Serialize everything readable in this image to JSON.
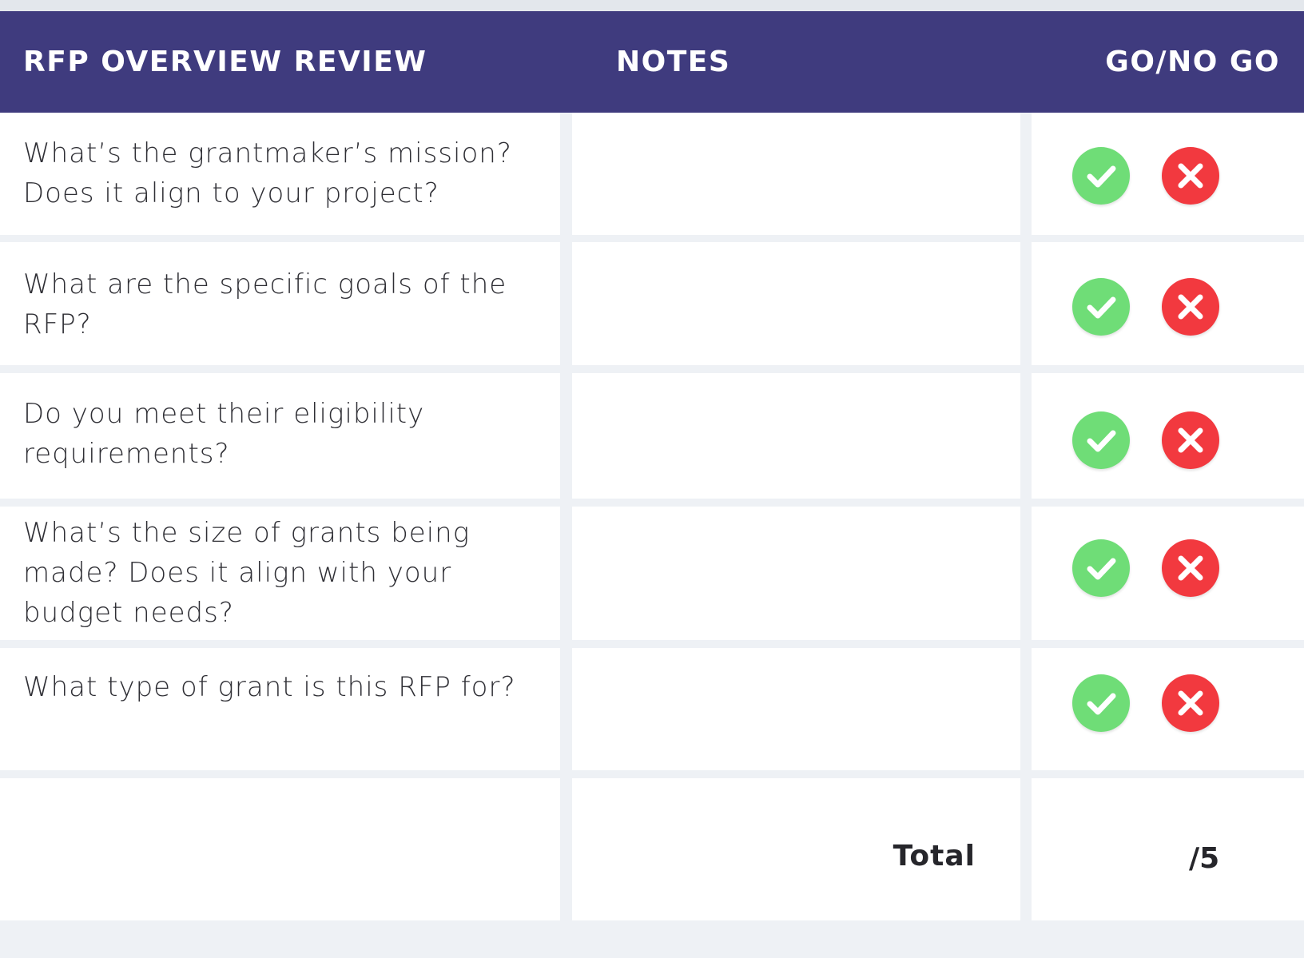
{
  "header": {
    "question_col": "RFP OVERVIEW REVIEW",
    "notes_col": "NOTES",
    "go_col": "GO/NO GO"
  },
  "rows": [
    {
      "question": "What’s the grantmaker’s mission? Does it align to your project?",
      "notes": "",
      "go_icon": "check-icon",
      "nogo_icon": "x-icon"
    },
    {
      "question": "What are the specific goals of the RFP?",
      "notes": "",
      "go_icon": "check-icon",
      "nogo_icon": "x-icon"
    },
    {
      "question": "Do you meet their eligibility requirements?",
      "notes": "",
      "go_icon": "check-icon",
      "nogo_icon": "x-icon"
    },
    {
      "question": "What’s the size of grants being made? Does it align with your budget needs?",
      "notes": "",
      "go_icon": "check-icon",
      "nogo_icon": "x-icon"
    },
    {
      "question": "What type of grant is this RFP for?",
      "notes": "",
      "go_icon": "check-icon",
      "nogo_icon": "x-icon"
    }
  ],
  "footer": {
    "total_label": "Total",
    "total_value": "/5"
  },
  "colors": {
    "header_bg": "#3f3b7e",
    "go": "#6fdd77",
    "nogo": "#f2393f",
    "grid": "#eef1f5"
  }
}
